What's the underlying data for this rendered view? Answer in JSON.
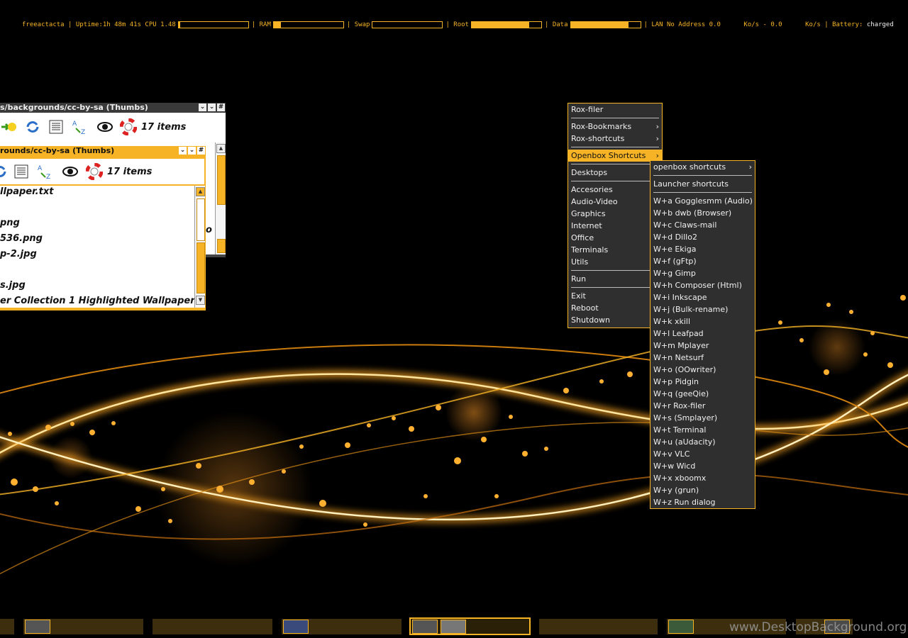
{
  "conky": {
    "host": "freeactacta",
    "uptime_label": "Uptime:",
    "uptime": "1h 48m 41s",
    "cpu_label": "CPU",
    "cpu": "1.48",
    "cpu_pct": 2,
    "ram_label": "RAM",
    "ram_pct": 10,
    "swap_label": "Swap",
    "swap_pct": 0,
    "root_label": "Root",
    "root_pct": 83,
    "data_label": "Data",
    "data_pct": 83,
    "lan": "LAN No Address 0.0",
    "down": "Ko/s - 0.0",
    "up": "Ko/s",
    "battery_label": "Battery:",
    "battery": "charged",
    "color": "#f5b325"
  },
  "window_back": {
    "title": "s/backgrounds/cc-by-sa (Thumbs)",
    "count": "17 items",
    "partial_text": "o",
    "icons": [
      "home-forward-icon",
      "refresh-icon",
      "details-icon",
      "sort-icon",
      "eye-icon",
      "help-icon"
    ]
  },
  "window_front": {
    "title": "rounds/cc-by-sa (Thumbs)",
    "count": "17 items",
    "files": [
      "llpaper.txt",
      "png",
      "536.png",
      "p-2.jpg",
      "s.jpg",
      "er Collection 1 Highlighted Wallpaper"
    ]
  },
  "main_menu": {
    "items": [
      {
        "label": "Rox-filer",
        "sub": false
      },
      {
        "label": "Rox-Bookmarks",
        "sub": true
      },
      {
        "label": "Rox-shortcuts",
        "sub": true
      },
      {
        "label": "Openbox Shortcuts",
        "sub": true,
        "selected": true
      },
      {
        "label": "Desktops",
        "sub": false
      },
      {
        "label": "Accesories",
        "sub": false
      },
      {
        "label": "Audio-Video",
        "sub": false
      },
      {
        "label": "Graphics",
        "sub": false
      },
      {
        "label": "Internet",
        "sub": false
      },
      {
        "label": "Office",
        "sub": false
      },
      {
        "label": "Terminals",
        "sub": false
      },
      {
        "label": "Utils",
        "sub": false
      },
      {
        "label": "Run",
        "sub": false
      },
      {
        "label": "Exit",
        "sub": false
      },
      {
        "label": "Reboot",
        "sub": false
      },
      {
        "label": "Shutdown",
        "sub": false
      }
    ]
  },
  "sub_menu": {
    "header_items": [
      {
        "label": "openbox shortcuts",
        "sub": true
      },
      {
        "label": "Launcher shortcuts",
        "sub": false
      }
    ],
    "items": [
      "W+a Gogglesmm (Audio)",
      "W+b dwb (Browser)",
      "W+c Claws-mail",
      "W+d Dillo2",
      "W+e Ekiga",
      "W+f (gFtp)",
      "W+g Gimp",
      "W+h Composer (Html)",
      "W+i Inkscape",
      "W+j (Bulk-rename)",
      "W+k xkill",
      "W+l Leafpad",
      "W+m Mplayer",
      "W+n Netsurf",
      "W+o (OOwriter)",
      "W+p Pidgin",
      "W+q (geeQie)",
      "W+r Rox-filer",
      "W+s (Smplayer)",
      "W+t Terminal",
      "W+u (aUdacity)",
      "W+v VLC",
      "W+w Wicd",
      "W+x xboomx",
      "W+y (grun)",
      "W+z Run dialog"
    ]
  },
  "taskbar": {
    "icons": [
      "terminal-icon",
      "browser-icon",
      "terminal-icon",
      "terminal-icon",
      "settings-icon"
    ]
  },
  "watermark": "www.DesktopBackground.org"
}
